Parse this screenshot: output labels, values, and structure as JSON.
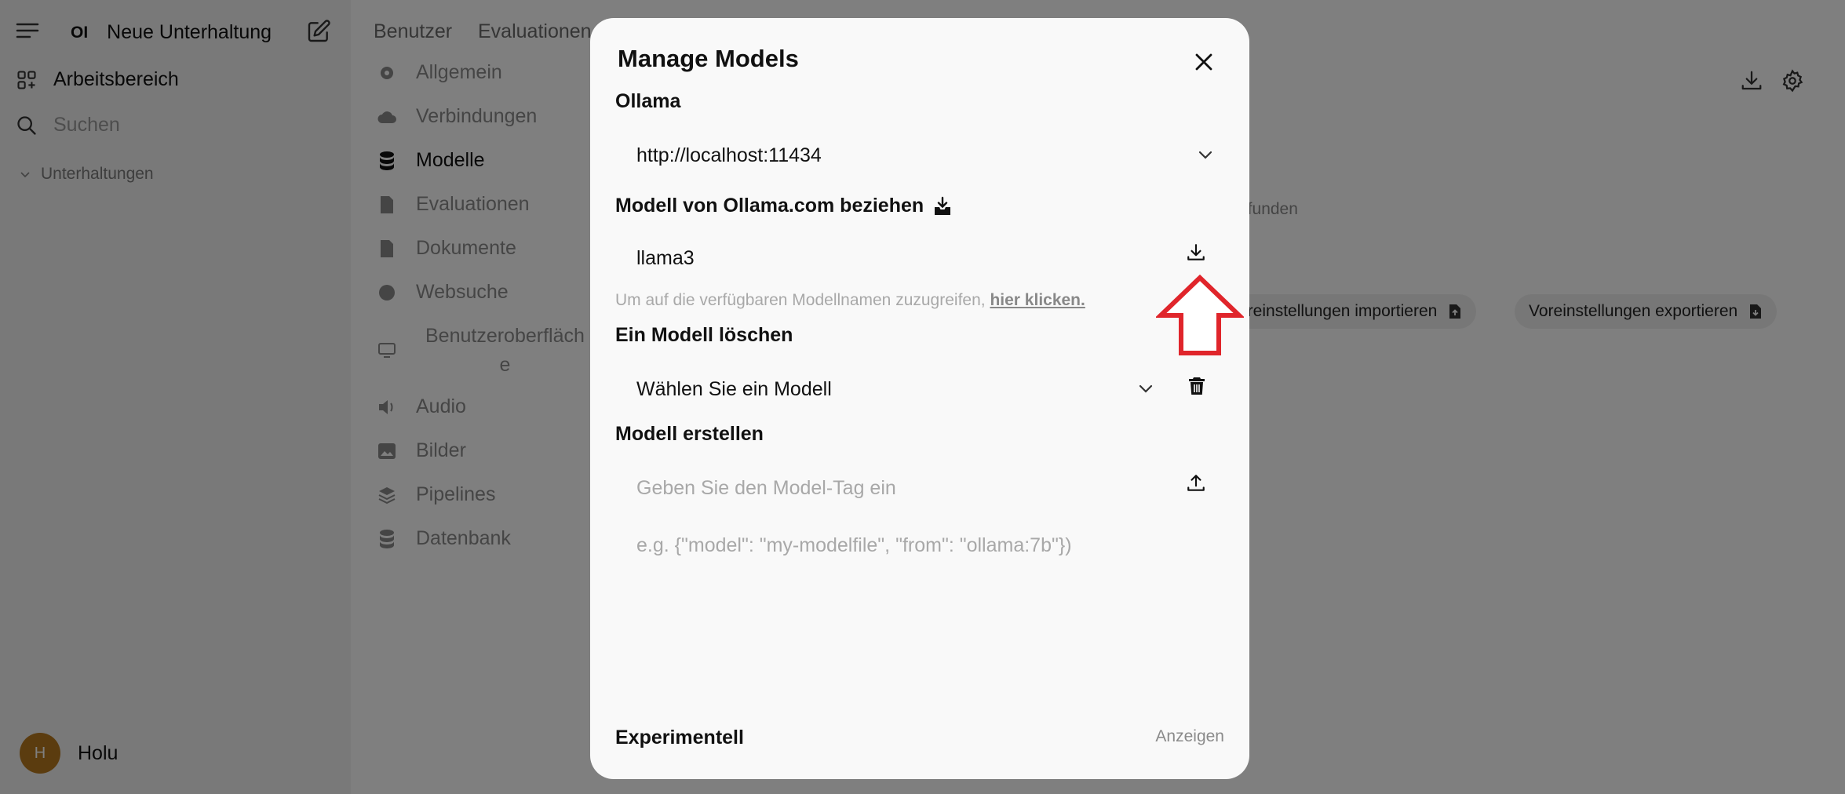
{
  "sidebar": {
    "new_chat": "Neue Unterhaltung",
    "workspace": "Arbeitsbereich",
    "search_placeholder": "Suchen",
    "conversations": "Unterhaltungen",
    "user_initial": "H",
    "user_name": "Holu",
    "avatar_color": "#b7791f"
  },
  "header": {
    "tabs": [
      "Benutzer",
      "Evaluationen"
    ]
  },
  "settings_nav": [
    {
      "label": "Allgemein",
      "icon": "gear-icon"
    },
    {
      "label": "Verbindungen",
      "icon": "cloud-icon"
    },
    {
      "label": "Modelle",
      "icon": "database-icon",
      "active": true
    },
    {
      "label": "Evaluationen",
      "icon": "document-icon"
    },
    {
      "label": "Dokumente",
      "icon": "document-icon"
    },
    {
      "label": "Websuche",
      "icon": "globe-icon"
    },
    {
      "label": "Benutzeroberfläch",
      "label_line2": "e",
      "icon": "monitor-icon"
    },
    {
      "label": "Audio",
      "icon": "speaker-icon"
    },
    {
      "label": "Bilder",
      "icon": "image-icon"
    },
    {
      "label": "Pipelines",
      "icon": "layers-icon"
    },
    {
      "label": "Datenbank",
      "icon": "database-icon"
    }
  ],
  "main": {
    "not_found_fragment": "efunden",
    "import_presets": "Voreinstellungen importieren",
    "import_presets_visible": "oreinstellungen importieren",
    "export_presets": "Voreinstellungen exportieren"
  },
  "modal": {
    "title": "Manage Models",
    "ollama_label": "Ollama",
    "ollama_url": "http://localhost:11434",
    "pull_label": "Modell von Ollama.com beziehen",
    "pull_value": "llama3",
    "hint_text": "Um auf die verfügbaren Modellnamen zuzugreifen,",
    "hint_link": "hier klicken.",
    "delete_label": "Ein Modell löschen",
    "delete_select": "Wählen Sie ein Modell",
    "create_label": "Modell erstellen",
    "create_tag_placeholder": "Geben Sie den Model-Tag ein",
    "create_modelfile_placeholder": "e.g. {\"model\": \"my-modelfile\", \"from\": \"ollama:7b\"})",
    "experimental_label": "Experimentell",
    "show_label": "Anzeigen"
  },
  "colors": {
    "overlay": "rgba(0,0,0,0.5)",
    "modal_bg": "#f9f9f9",
    "annotation_arrow": "#e0252b"
  }
}
